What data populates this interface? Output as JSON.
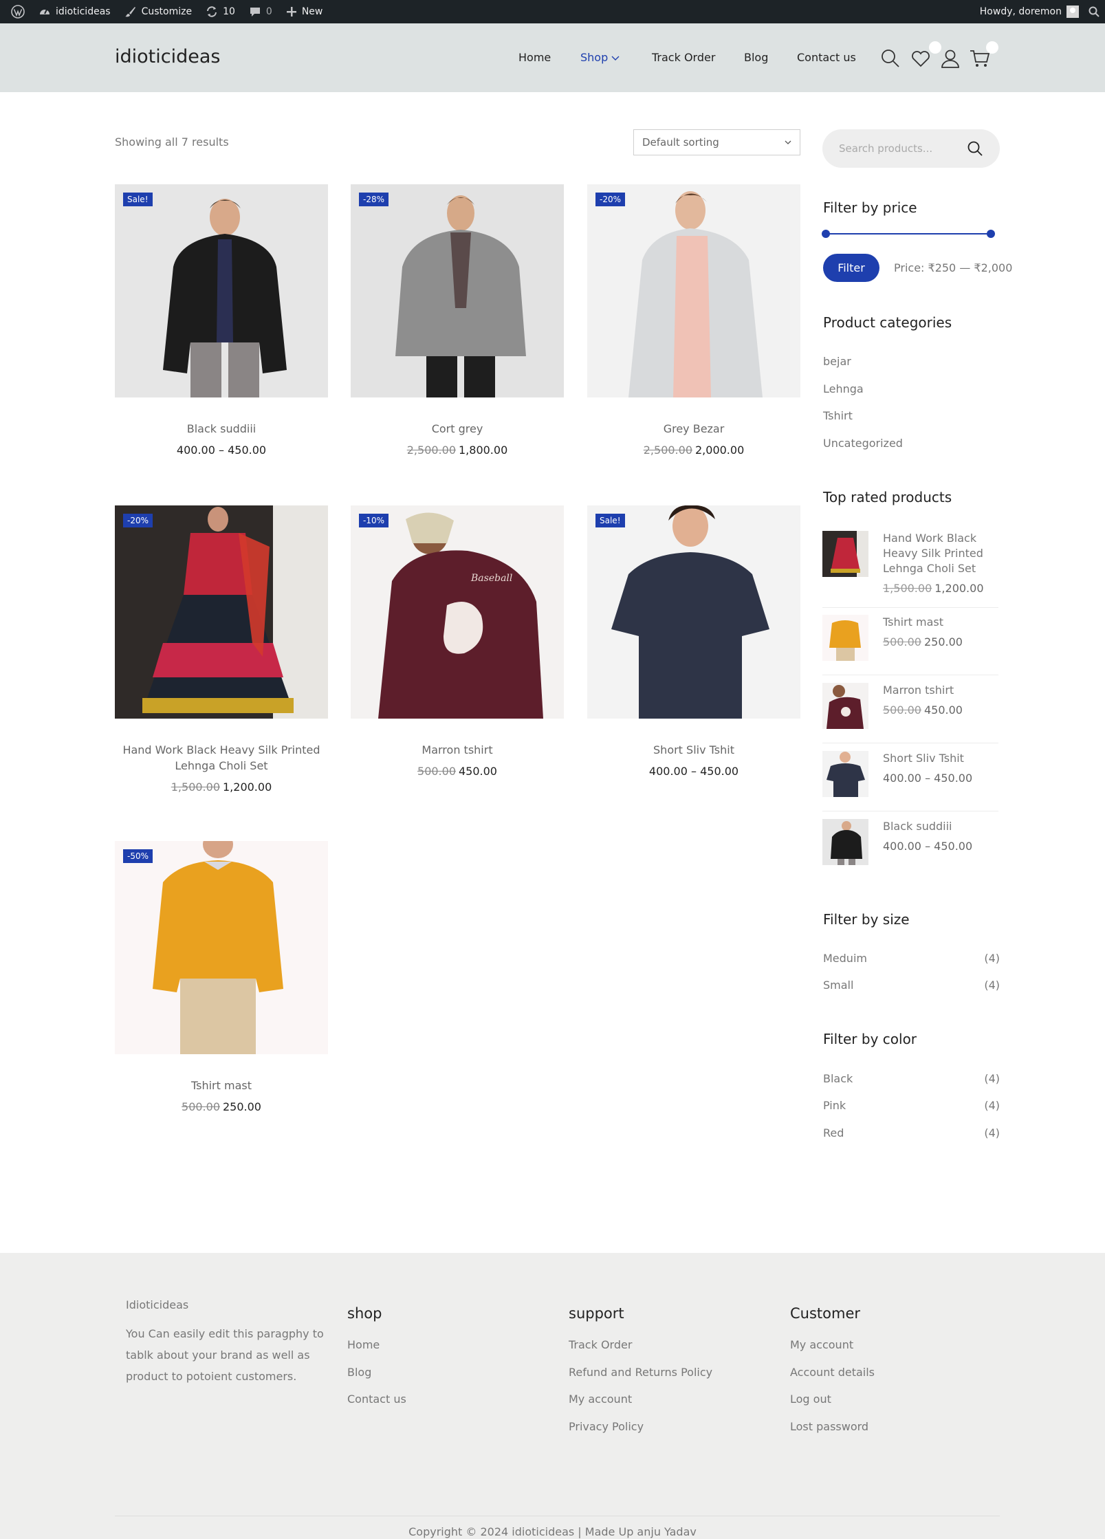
{
  "adminbar": {
    "site_name": "idioticideas",
    "customize": "Customize",
    "updates_count": "10",
    "comments_count": "0",
    "new": "New",
    "howdy": "Howdy, doremon"
  },
  "header": {
    "logo": "idioticideas",
    "nav": {
      "home": "Home",
      "shop": "Shop",
      "track": "Track Order",
      "blog": "Blog",
      "contact": "Contact us"
    }
  },
  "toolbar": {
    "result_count": "Showing all 7 results",
    "sort_value": "Default sorting"
  },
  "products": [
    {
      "name": "Black suddiii",
      "badge": "Sale!",
      "old_price": "",
      "price": "400.00 – 450.00"
    },
    {
      "name": "Cort grey",
      "badge": "-28%",
      "old_price": "2,500.00",
      "price": "1,800.00"
    },
    {
      "name": "Grey Bezar",
      "badge": "-20%",
      "old_price": "2,500.00",
      "price": "2,000.00"
    },
    {
      "name": "Hand Work Black Heavy Silk Printed Lehnga Choli Set",
      "badge": "-20%",
      "old_price": "1,500.00",
      "price": "1,200.00"
    },
    {
      "name": "Marron tshirt",
      "badge": "-10%",
      "old_price": "500.00",
      "price": "450.00"
    },
    {
      "name": "Short Sliv Tshit",
      "badge": "Sale!",
      "old_price": "",
      "price": "400.00 – 450.00"
    },
    {
      "name": "Tshirt mast",
      "badge": "-50%",
      "old_price": "500.00",
      "price": "250.00"
    }
  ],
  "sidebar": {
    "search_placeholder": "Search products...",
    "filter_price_title": "Filter by price",
    "filter_button": "Filter",
    "price_range": "Price: ₹250 — ₹2,000",
    "categories_title": "Product categories",
    "categories": [
      "bejar",
      "Lehnga",
      "Tshirt",
      "Uncategorized"
    ],
    "top_rated_title": "Top rated products",
    "top_rated": [
      {
        "name": "Hand Work Black Heavy Silk Printed Lehnga Choli Set",
        "old_price": "1,500.00",
        "price": "1,200.00"
      },
      {
        "name": "Tshirt mast",
        "old_price": "500.00",
        "price": "250.00"
      },
      {
        "name": "Marron tshirt",
        "old_price": "500.00",
        "price": "450.00"
      },
      {
        "name": "Short Sliv Tshit",
        "old_price": "",
        "price": "400.00 – 450.00"
      },
      {
        "name": "Black suddiii",
        "old_price": "",
        "price": "400.00 – 450.00"
      }
    ],
    "size_title": "Filter by size",
    "sizes": [
      {
        "label": "Meduim",
        "count": "(4)"
      },
      {
        "label": "Small",
        "count": "(4)"
      }
    ],
    "color_title": "Filter by color",
    "colors": [
      {
        "label": "Black",
        "count": "(4)"
      },
      {
        "label": "Pink",
        "count": "(4)"
      },
      {
        "label": "Red",
        "count": "(4)"
      }
    ]
  },
  "footer": {
    "brand": "Idioticideas",
    "description": "You Can easily edit this paragphy to tablk about your brand as well as product to potoient customers.",
    "shop_title": "shop",
    "shop_links": [
      "Home",
      "Blog",
      "Contact us"
    ],
    "support_title": "support",
    "support_links": [
      "Track Order",
      "Refund and Returns Policy",
      "My account",
      "Privacy Policy"
    ],
    "customer_title": "Customer",
    "customer_links": [
      "My account",
      "Account details",
      "Log out",
      "Lost password"
    ],
    "copyright": "Copyright © 2024 idioticideas | Made Up anju Yadav"
  },
  "colors": {
    "accent": "#1e3fae",
    "header_bg": "#dde2e2",
    "footer_bg": "#eeeeed",
    "adminbar_bg": "#1d2327"
  }
}
